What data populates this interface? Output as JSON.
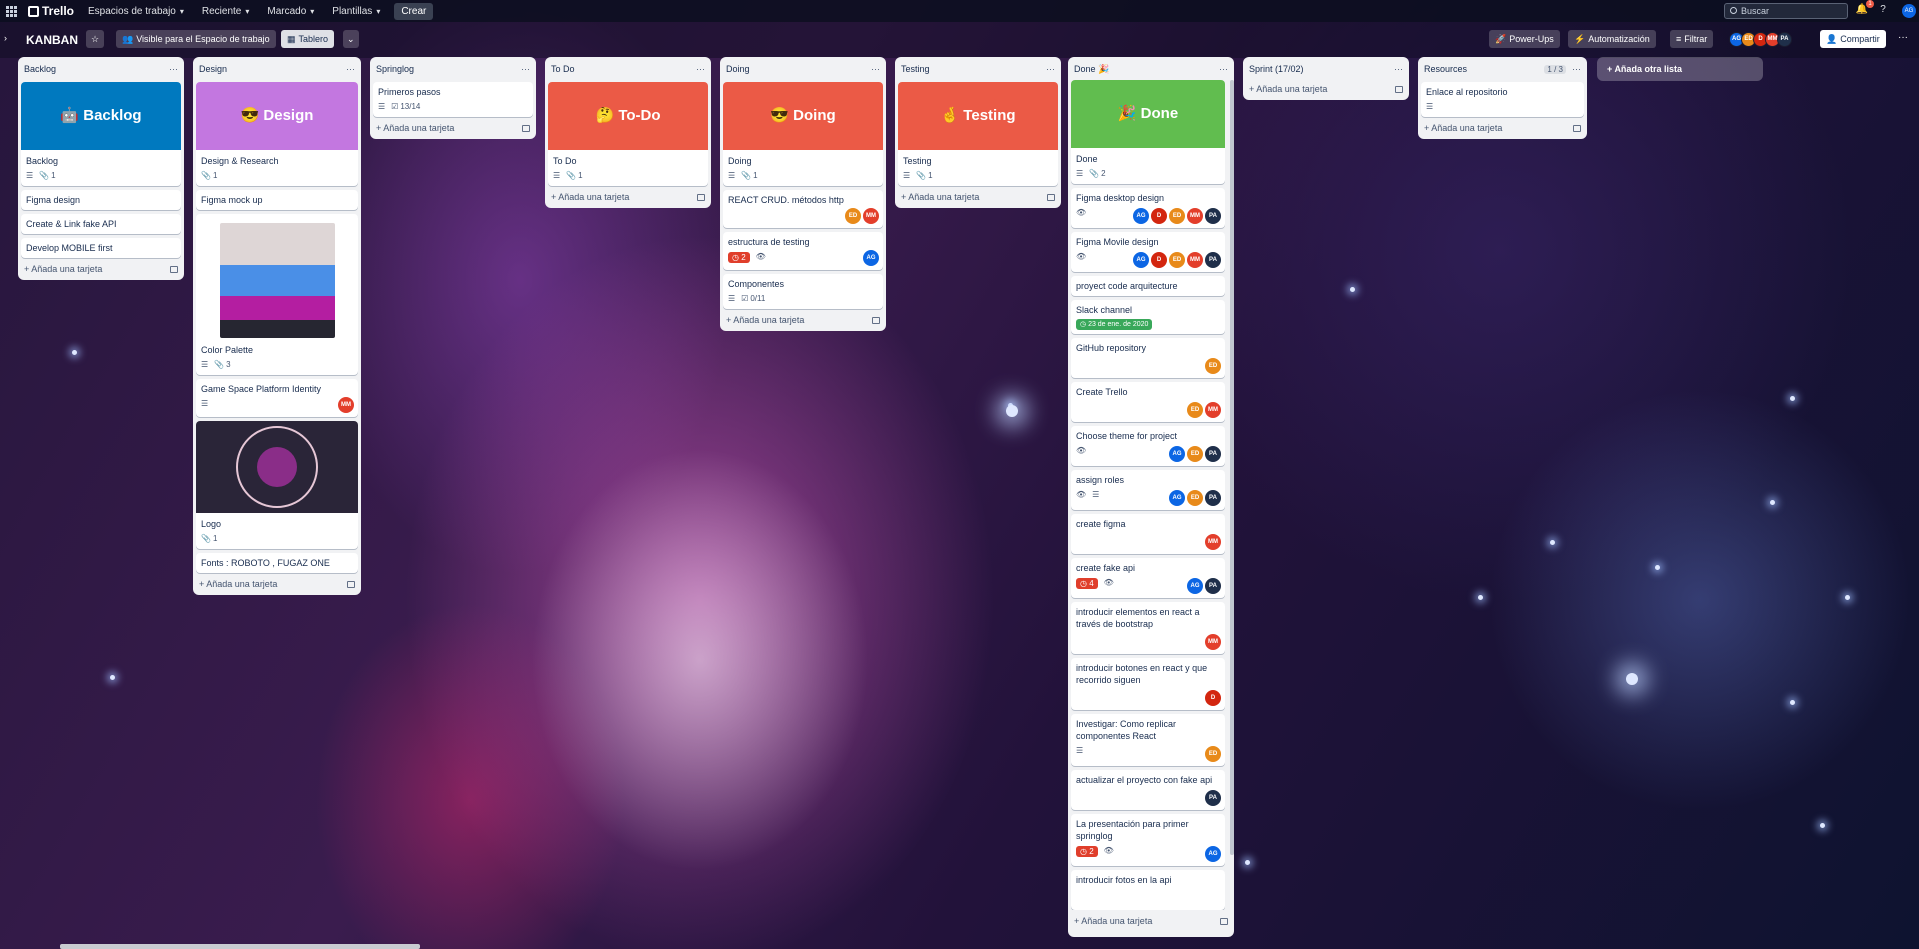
{
  "topbar": {
    "brand": "Trello",
    "menus": [
      "Espacios de trabajo",
      "Reciente",
      "Marcado",
      "Plantillas"
    ],
    "create_label": "Crear",
    "search_placeholder": "Buscar",
    "notification_count": "1",
    "user_initials": "AG"
  },
  "board": {
    "title": "KANBAN",
    "visibility_label": "Visible para el Espacio de trabajo",
    "view_label": "Tablero",
    "powerups_label": "Power-Ups",
    "automation_label": "Automatización",
    "filter_label": "Filtrar",
    "members": [
      "AG",
      "ED",
      "D",
      "MM",
      "PA"
    ],
    "share_label": "Compartir",
    "add_card_label": "Añada una tarjeta",
    "add_list_label": "Añada otra lista"
  },
  "colors": {
    "AG": "#0c66e4",
    "ED": "#e88a1a",
    "D": "#d3260f",
    "MM": "#e33e2b",
    "PA": "#1f2f4a",
    "cover_blue": "#0079bf",
    "cover_purple": "#c377e0",
    "cover_red": "#eb5a46",
    "cover_green": "#61bd4f"
  },
  "lists": {
    "backlog": {
      "title": "Backlog",
      "cover_title": "🤖 Backlog",
      "cards": [
        {
          "title": "Backlog",
          "attachments": "1"
        },
        {
          "title": "Figma design"
        },
        {
          "title": "Create & Link fake API"
        },
        {
          "title": "Develop MOBILE first"
        }
      ]
    },
    "design": {
      "title": "Design",
      "cover_title": "😎 Design",
      "cards": [
        {
          "title": "Design & Research",
          "attachments": "1"
        },
        {
          "title": "Figma mock up"
        },
        {
          "title": "Color Palette",
          "attachments": "3",
          "palette": [
            "#ded6d6",
            "#4a8fe7",
            "#b41ea1",
            "#262631"
          ]
        },
        {
          "title": "Game Space Platform Identity",
          "member": "MM"
        },
        {
          "title": "Logo",
          "attachments": "1"
        },
        {
          "title": "Fonts : ROBOTO , FUGAZ ONE"
        }
      ]
    },
    "springlog": {
      "title": "Springlog",
      "cards": [
        {
          "title": "Primeros pasos",
          "checklist": "13/14"
        }
      ]
    },
    "todo": {
      "title": "To Do",
      "cover_title": "🤔 To-Do",
      "cards": [
        {
          "title": "To Do",
          "attachments": "1"
        }
      ]
    },
    "doing": {
      "title": "Doing",
      "cover_title": "😎 Doing",
      "cards": [
        {
          "title": "Doing",
          "attachments": "1"
        },
        {
          "title": "REACT CRUD. métodos http",
          "members": [
            "ED",
            "MM"
          ]
        },
        {
          "title": "estructura de testing",
          "label": "2",
          "members": [
            "AG"
          ]
        },
        {
          "title": "Componentes",
          "checklist": "0/11"
        }
      ]
    },
    "testing": {
      "title": "Testing",
      "cover_title": "🤞 Testing",
      "cards": [
        {
          "title": "Testing",
          "attachments": "1"
        }
      ]
    },
    "done": {
      "title": "Done 🎉",
      "cover_title": "🎉 Done",
      "cards": [
        {
          "title": "Done",
          "attachments": "2"
        },
        {
          "title": "Figma desktop design",
          "members": [
            "AG",
            "D",
            "ED",
            "MM",
            "PA"
          ]
        },
        {
          "title": "Figma Movile design",
          "members": [
            "AG",
            "D",
            "ED",
            "MM",
            "PA"
          ]
        },
        {
          "title": "proyect code arquitecture"
        },
        {
          "title": "Slack channel",
          "date": "23 de ene. de 2020"
        },
        {
          "title": "GitHub repository",
          "members": [
            "ED"
          ]
        },
        {
          "title": "Create Trello",
          "members": [
            "ED",
            "MM"
          ]
        },
        {
          "title": "Choose theme for project",
          "members": [
            "AG",
            "ED",
            "PA"
          ]
        },
        {
          "title": "assign roles",
          "members": [
            "AG",
            "ED",
            "PA"
          ]
        },
        {
          "title": "create figma",
          "members": [
            "MM"
          ]
        },
        {
          "title": "create fake api",
          "label": "4",
          "members": [
            "AG",
            "PA"
          ]
        },
        {
          "title": "introducir elementos en react a través de bootstrap",
          "members": [
            "MM"
          ]
        },
        {
          "title": "introducir botones en react y que recorrido siguen",
          "members": [
            "D"
          ]
        },
        {
          "title": "Investigar: Como replicar componentes React",
          "members": [
            "ED"
          ]
        },
        {
          "title": "actualizar el proyecto con fake api",
          "members": [
            "PA"
          ]
        },
        {
          "title": "La presentación para primer springlog",
          "label": "2",
          "members": [
            "AG"
          ]
        },
        {
          "title": "introducir fotos en la api"
        }
      ]
    },
    "sprint": {
      "title": "Sprint (17/02)"
    },
    "resources": {
      "title": "Resources",
      "limit": "1 / 3",
      "cards": [
        {
          "title": "Enlace al repositorio"
        }
      ]
    }
  }
}
